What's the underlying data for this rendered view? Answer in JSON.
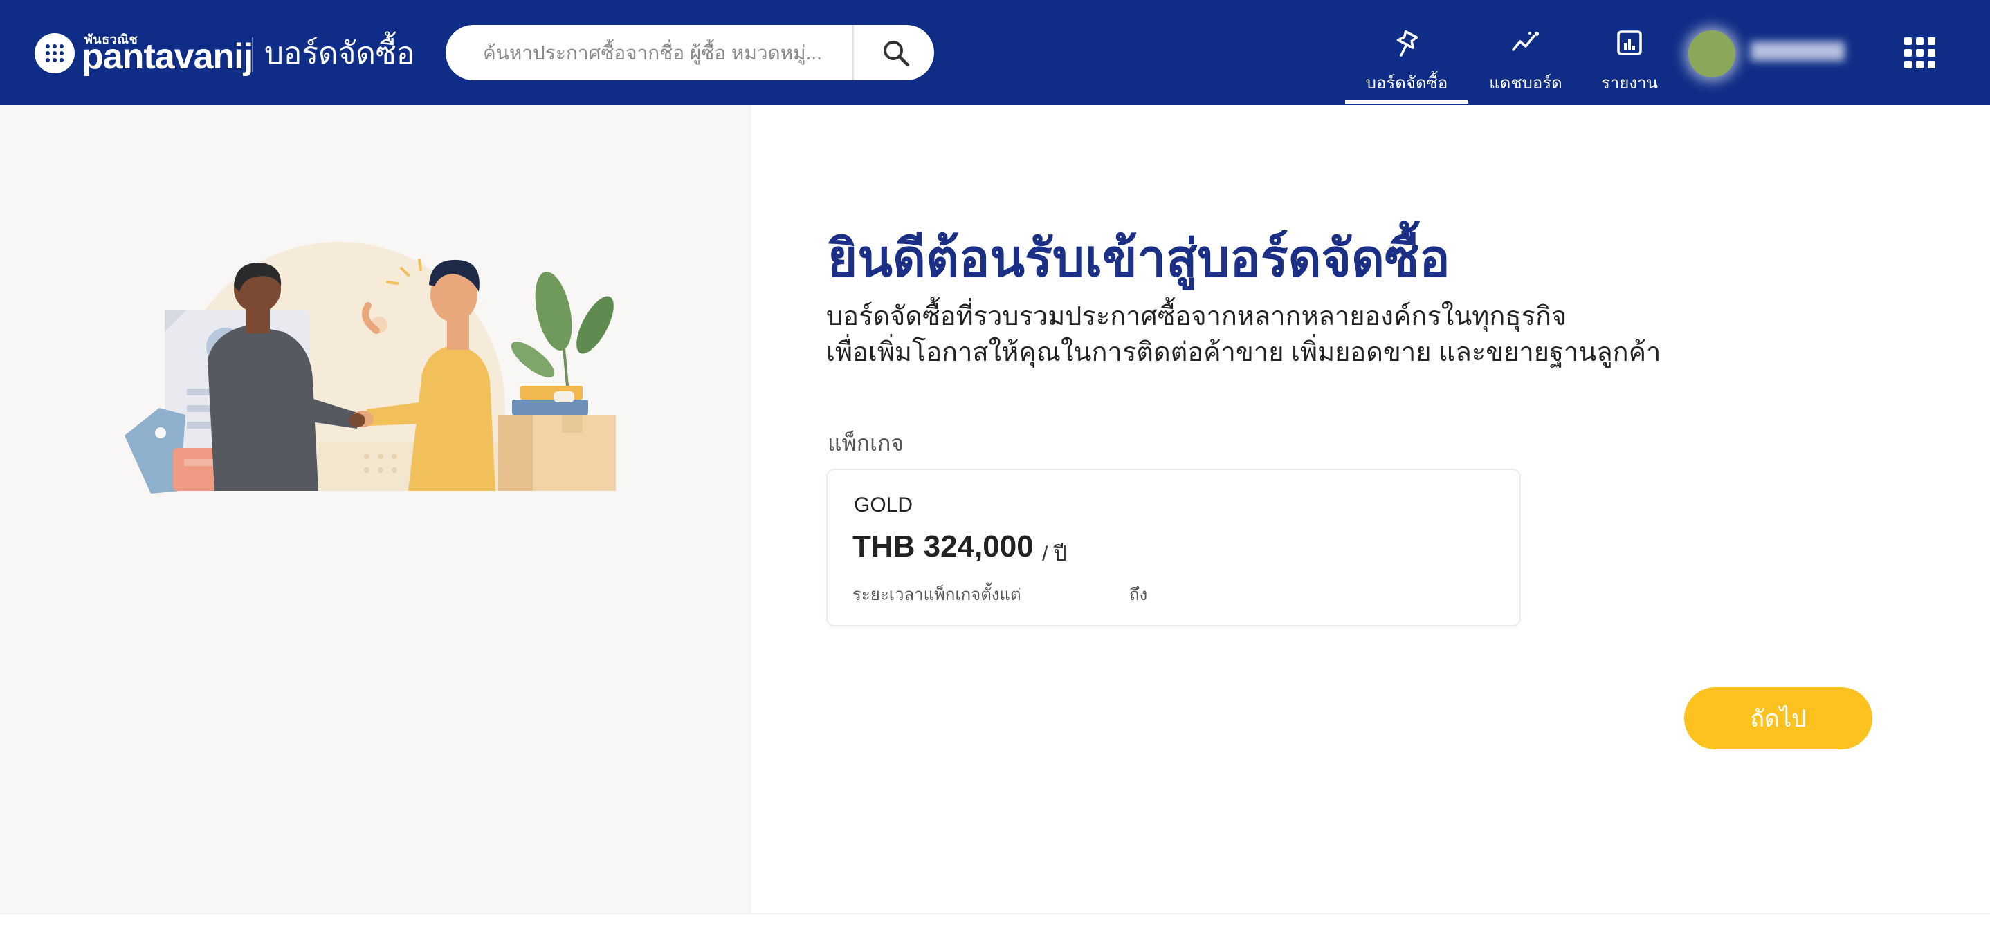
{
  "header": {
    "logo_small": "พันธวณิช",
    "logo_word": "pantavanij",
    "board_title": "บอร์ดจัดซื้อ",
    "search_placeholder": "ค้นหาประกาศซื้อจากชื่อ ผู้ซื้อ หมวดหมู่...",
    "search_icon": "search-icon",
    "nav": [
      {
        "label": "บอร์ดจัดซื้อ",
        "icon": "pin-icon",
        "active": true
      },
      {
        "label": "แดชบอร์ด",
        "icon": "trend-line-icon",
        "active": false
      },
      {
        "label": "รายงาน",
        "icon": "report-icon",
        "active": false
      }
    ],
    "apps_icon": "apps-grid-icon",
    "brand_color": "#0f2d86"
  },
  "main": {
    "welcome_title": "ยินดีต้อนรับเข้าสู่บอร์ดจัดซื้อ",
    "description_line1": "บอร์ดจัดซื้อที่รวบรวมประกาศซื้อจากหลากหลายองค์กรในทุกธุรกิจ",
    "description_line2": "เพื่อเพิ่มโอกาสให้คุณในการติดต่อค้าขาย เพิ่มยอดขาย และขยายฐานลูกค้า",
    "package_label": "แพ็กเกจ",
    "package": {
      "name": "GOLD",
      "price": "THB 324,000",
      "per": "/ ปี",
      "period_label": "ระยะเวลาแพ็กเกจตั้งแต่",
      "to_label": "ถึง"
    },
    "next_button": "ถัดไป",
    "accent_color": "#fcc220"
  }
}
